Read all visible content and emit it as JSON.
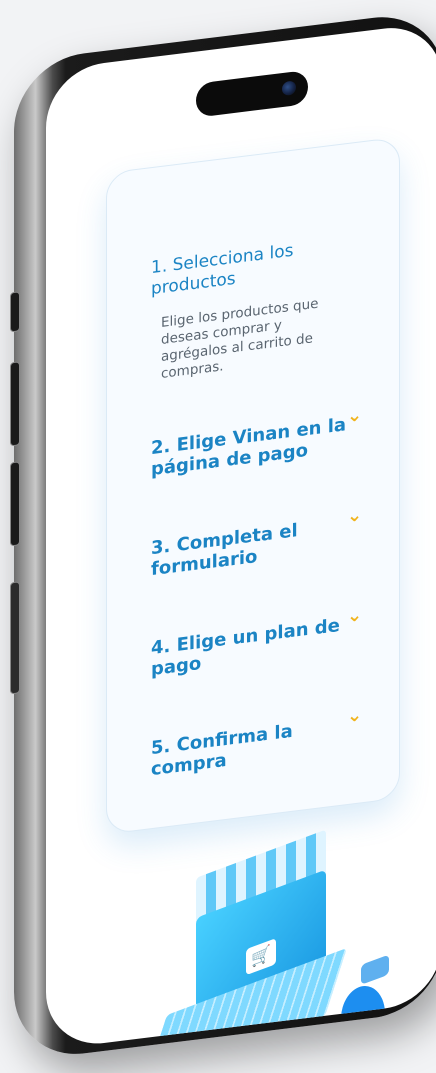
{
  "steps": [
    {
      "title": "1. Selecciona los productos",
      "description": "Elige los productos que deseas comprar y agrégalos al carrito de compras.",
      "expanded": true
    },
    {
      "title": "2. Elige Vinan en la página de pago",
      "expanded": false
    },
    {
      "title": "3. Completa el formulario",
      "expanded": false
    },
    {
      "title": "4. Elige un plan de pago",
      "expanded": false
    },
    {
      "title": "5. Confirma la compra",
      "expanded": false
    }
  ],
  "icons": {
    "chevron": "chevron-down-icon",
    "cart": "shopping-cart-icon"
  },
  "colors": {
    "title": "#1b84c4",
    "chevron": "#f0b31b",
    "card_bg": "#f7fbff"
  }
}
